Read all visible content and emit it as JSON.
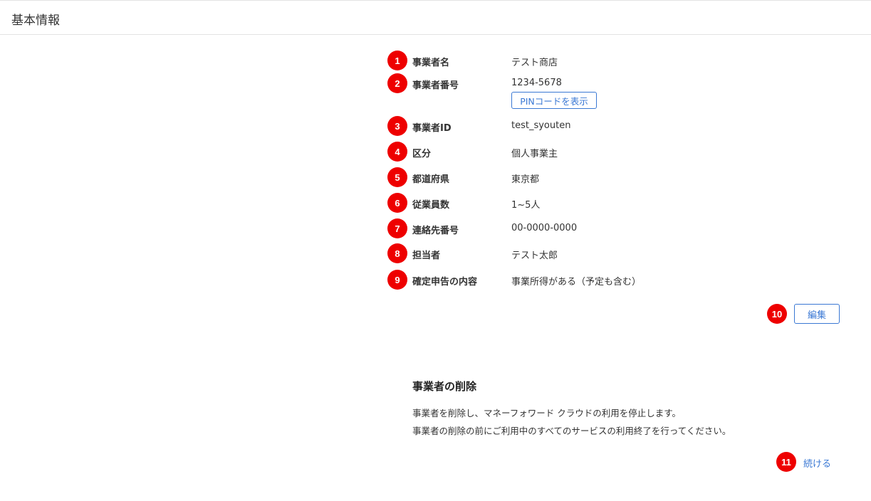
{
  "header": {
    "title": "基本情報"
  },
  "badges": [
    "1",
    "2",
    "3",
    "4",
    "5",
    "6",
    "7",
    "8",
    "9",
    "10",
    "11"
  ],
  "fields": [
    {
      "label": "事業者名",
      "value": "テスト商店"
    },
    {
      "label": "事業者番号",
      "value": "1234-5678"
    },
    {
      "label": "事業者ID",
      "value": "test_syouten"
    },
    {
      "label": "区分",
      "value": "個人事業主"
    },
    {
      "label": "都道府県",
      "value": "東京都"
    },
    {
      "label": "従業員数",
      "value": "1~5人"
    },
    {
      "label": "連絡先番号",
      "value": "00-0000-0000"
    },
    {
      "label": "担当者",
      "value": "テスト太郎"
    },
    {
      "label": "確定申告の内容",
      "value": "事業所得がある（予定も含む）"
    }
  ],
  "pin_button": {
    "label": "PINコードを表示"
  },
  "edit_button": {
    "label": "編集"
  },
  "delete_section": {
    "title": "事業者の削除",
    "line1": "事業者を削除し、マネーフォワード クラウドの利用を停止します。",
    "line2": "事業者の削除の前にご利用中のすべてのサービスの利用終了を行ってください。",
    "continue_label": "続ける"
  },
  "colors": {
    "accent": "#3a78d4",
    "badge": "#ee0000",
    "border": "#e3e3e3"
  }
}
